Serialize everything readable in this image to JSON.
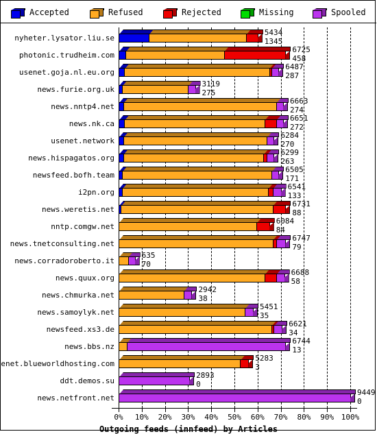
{
  "legend": {
    "items": [
      {
        "label": "Accepted",
        "color": "#0000ee",
        "icon": "cube-icon"
      },
      {
        "label": "Refused",
        "color": "#ffaa22",
        "icon": "cube-icon"
      },
      {
        "label": "Rejected",
        "color": "#ee0000",
        "icon": "cube-icon"
      },
      {
        "label": "Missing",
        "color": "#00dd00",
        "icon": "cube-icon"
      },
      {
        "label": "Spooled",
        "color": "#bb33ee",
        "icon": "cube-icon"
      }
    ]
  },
  "axis": {
    "title": "Outgoing feeds (innfeed) by Articles",
    "ticks": [
      "0%",
      "10%",
      "20%",
      "30%",
      "40%",
      "50%",
      "60%",
      "70%",
      "80%",
      "90%",
      "100%"
    ],
    "min": 0,
    "max": 100
  },
  "chart_data": {
    "type": "bar",
    "orientation": "horizontal",
    "stacked": true,
    "title": "Outgoing feeds (innfeed) by Articles",
    "xlabel": "Outgoing feeds (innfeed) by Articles",
    "ylabel": "",
    "xlim": [
      0,
      100
    ],
    "xtick_labels": [
      "0%",
      "10%",
      "20%",
      "30%",
      "40%",
      "50%",
      "60%",
      "70%",
      "80%",
      "90%",
      "100%"
    ],
    "grid": true,
    "legend_position": "top",
    "series": [
      {
        "name": "Accepted",
        "color": "#0000ee"
      },
      {
        "name": "Refused",
        "color": "#ffaa22"
      },
      {
        "name": "Rejected",
        "color": "#ee0000"
      },
      {
        "name": "Missing",
        "color": "#00dd00"
      },
      {
        "name": "Spooled",
        "color": "#bb33ee"
      }
    ],
    "categories": [
      "nyheter.lysator.liu.se",
      "photonic.trudheim.com",
      "usenet.goja.nl.eu.org",
      "news.furie.org.uk",
      "news.nntp4.net",
      "news.nk.ca",
      "usenet.network",
      "news.hispagatos.org",
      "newsfeed.bofh.team",
      "i2pn.org",
      "news.weretis.net",
      "nntp.comgw.net",
      "news.tnetconsulting.net",
      "news.corradoroberto.it",
      "news.quux.org",
      "news.chmurka.net",
      "news.samoylyk.net",
      "newsfeed.xs3.de",
      "news.bbs.nz",
      "usenet.blueworldhosting.com",
      "ddt.demos.su",
      "news.netfront.net"
    ],
    "rows": [
      {
        "label": "nyheter.lysator.liu.se",
        "total": 5434,
        "second": 1345,
        "bar_pct": 60.0,
        "segments": [
          {
            "name": "Accepted",
            "pct": 13.0
          },
          {
            "name": "Refused",
            "pct": 42.0
          },
          {
            "name": "Rejected",
            "pct": 5.0
          }
        ]
      },
      {
        "label": "photonic.trudheim.com",
        "total": 6725,
        "second": 458,
        "bar_pct": 72.0,
        "segments": [
          {
            "name": "Accepted",
            "pct": 3.0
          },
          {
            "name": "Refused",
            "pct": 42.5
          },
          {
            "name": "Rejected",
            "pct": 26.5
          }
        ]
      },
      {
        "label": "usenet.goja.nl.eu.org",
        "total": 6487,
        "second": 287,
        "bar_pct": 69.0,
        "segments": [
          {
            "name": "Accepted",
            "pct": 2.5
          },
          {
            "name": "Refused",
            "pct": 62.5
          },
          {
            "name": "Rejected",
            "pct": 1.0
          },
          {
            "name": "Spooled",
            "pct": 3.0
          }
        ]
      },
      {
        "label": "news.furie.org.uk",
        "total": 3119,
        "second": 275,
        "bar_pct": 33.0,
        "segments": [
          {
            "name": "Accepted",
            "pct": 1.5
          },
          {
            "name": "Refused",
            "pct": 28.5
          },
          {
            "name": "Spooled",
            "pct": 3.0
          }
        ]
      },
      {
        "label": "news.nntp4.net",
        "total": 6663,
        "second": 274,
        "bar_pct": 71.0,
        "segments": [
          {
            "name": "Accepted",
            "pct": 2.0
          },
          {
            "name": "Refused",
            "pct": 66.0
          },
          {
            "name": "Spooled",
            "pct": 3.0
          }
        ]
      },
      {
        "label": "news.nk.ca",
        "total": 6651,
        "second": 272,
        "bar_pct": 71.0,
        "segments": [
          {
            "name": "Accepted",
            "pct": 2.5
          },
          {
            "name": "Refused",
            "pct": 60.5
          },
          {
            "name": "Rejected",
            "pct": 5.0
          },
          {
            "name": "Spooled",
            "pct": 3.0
          }
        ]
      },
      {
        "label": "usenet.network",
        "total": 6284,
        "second": 270,
        "bar_pct": 67.0,
        "segments": [
          {
            "name": "Accepted",
            "pct": 2.0
          },
          {
            "name": "Refused",
            "pct": 62.0
          },
          {
            "name": "Spooled",
            "pct": 3.0
          }
        ]
      },
      {
        "label": "news.hispagatos.org",
        "total": 6299,
        "second": 263,
        "bar_pct": 67.0,
        "segments": [
          {
            "name": "Accepted",
            "pct": 2.0
          },
          {
            "name": "Refused",
            "pct": 60.5
          },
          {
            "name": "Rejected",
            "pct": 1.5
          },
          {
            "name": "Spooled",
            "pct": 3.0
          }
        ]
      },
      {
        "label": "newsfeed.bofh.team",
        "total": 6505,
        "second": 171,
        "bar_pct": 69.0,
        "segments": [
          {
            "name": "Accepted",
            "pct": 1.5
          },
          {
            "name": "Refused",
            "pct": 64.5
          },
          {
            "name": "Spooled",
            "pct": 3.0
          }
        ]
      },
      {
        "label": "i2pn.org",
        "total": 6541,
        "second": 133,
        "bar_pct": 70.0,
        "segments": [
          {
            "name": "Accepted",
            "pct": 1.5
          },
          {
            "name": "Refused",
            "pct": 63.0
          },
          {
            "name": "Rejected",
            "pct": 2.0
          },
          {
            "name": "Spooled",
            "pct": 3.5
          }
        ]
      },
      {
        "label": "news.weretis.net",
        "total": 6731,
        "second": 88,
        "bar_pct": 72.0,
        "segments": [
          {
            "name": "Accepted",
            "pct": 1.0
          },
          {
            "name": "Refused",
            "pct": 65.5
          },
          {
            "name": "Rejected",
            "pct": 5.5
          }
        ]
      },
      {
        "label": "nntp.comgw.net",
        "total": 6084,
        "second": 84,
        "bar_pct": 65.0,
        "segments": [
          {
            "name": "Refused",
            "pct": 59.5
          },
          {
            "name": "Rejected",
            "pct": 5.5
          }
        ]
      },
      {
        "label": "news.tnetconsulting.net",
        "total": 6747,
        "second": 79,
        "bar_pct": 72.0,
        "segments": [
          {
            "name": "Refused",
            "pct": 66.5
          },
          {
            "name": "Rejected",
            "pct": 1.5
          },
          {
            "name": "Spooled",
            "pct": 4.0
          }
        ]
      },
      {
        "label": "news.corradoroberto.it",
        "total": 635,
        "second": 70,
        "bar_pct": 7.0,
        "segments": [
          {
            "name": "Refused",
            "pct": 4.0
          },
          {
            "name": "Spooled",
            "pct": 3.0
          }
        ]
      },
      {
        "label": "news.quux.org",
        "total": 6688,
        "second": 58,
        "bar_pct": 71.5,
        "segments": [
          {
            "name": "Refused",
            "pct": 63.0
          },
          {
            "name": "Rejected",
            "pct": 5.0
          },
          {
            "name": "Spooled",
            "pct": 3.5
          }
        ]
      },
      {
        "label": "news.chmurka.net",
        "total": 2942,
        "second": 38,
        "bar_pct": 31.5,
        "segments": [
          {
            "name": "Refused",
            "pct": 28.0
          },
          {
            "name": "Spooled",
            "pct": 3.5
          }
        ]
      },
      {
        "label": "news.samoylyk.net",
        "total": 5451,
        "second": 35,
        "bar_pct": 58.0,
        "segments": [
          {
            "name": "Refused",
            "pct": 54.5
          },
          {
            "name": "Spooled",
            "pct": 3.5
          }
        ]
      },
      {
        "label": "newsfeed.xs3.de",
        "total": 6621,
        "second": 34,
        "bar_pct": 70.5,
        "segments": [
          {
            "name": "Refused",
            "pct": 66.0
          },
          {
            "name": "Rejected",
            "pct": 1.0
          },
          {
            "name": "Spooled",
            "pct": 3.5
          }
        ]
      },
      {
        "label": "news.bbs.nz",
        "total": 6744,
        "second": 13,
        "bar_pct": 72.0,
        "segments": [
          {
            "name": "Refused",
            "pct": 3.5
          },
          {
            "name": "Spooled",
            "pct": 68.5
          }
        ]
      },
      {
        "label": "usenet.blueworldhosting.com",
        "total": 5283,
        "second": 3,
        "bar_pct": 56.0,
        "segments": [
          {
            "name": "Refused",
            "pct": 52.5
          },
          {
            "name": "Rejected",
            "pct": 3.5
          }
        ]
      },
      {
        "label": "ddt.demos.su",
        "total": 2893,
        "second": 0,
        "bar_pct": 30.5,
        "segments": [
          {
            "name": "Spooled",
            "pct": 30.5
          }
        ]
      },
      {
        "label": "news.netfront.net",
        "total": 9449,
        "second": 0,
        "bar_pct": 100.0,
        "segments": [
          {
            "name": "Spooled",
            "pct": 100.0
          }
        ]
      }
    ]
  }
}
